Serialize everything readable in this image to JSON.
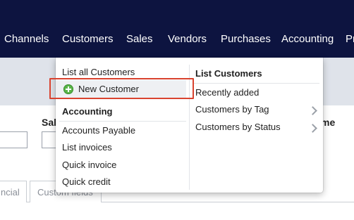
{
  "nav": {
    "items": [
      "Channels",
      "Customers",
      "Sales",
      "Vendors",
      "Purchases",
      "Accounting",
      "Pr"
    ],
    "background_color": "#0d1440",
    "active": "Customers"
  },
  "form": {
    "label_left": "Sal",
    "label_right": "me"
  },
  "tabs": {
    "items": [
      "ncial",
      "Custom fields"
    ]
  },
  "dropdown": {
    "left": {
      "items": {
        "list_all": "List all Customers",
        "new_customer": "New Customer",
        "accounts_payable": "Accounts Payable",
        "list_invoices": "List invoices",
        "quick_invoice": "Quick invoice",
        "quick_credit": "Quick credit"
      },
      "accounting_heading": "Accounting"
    },
    "right": {
      "heading": "List Customers",
      "items": {
        "recently_added": "Recently added",
        "by_tag": "Customers by Tag",
        "by_status": "Customers by Status"
      }
    },
    "highlight_color": "#d9432f",
    "new_customer_icon": "plus-circle-icon"
  }
}
